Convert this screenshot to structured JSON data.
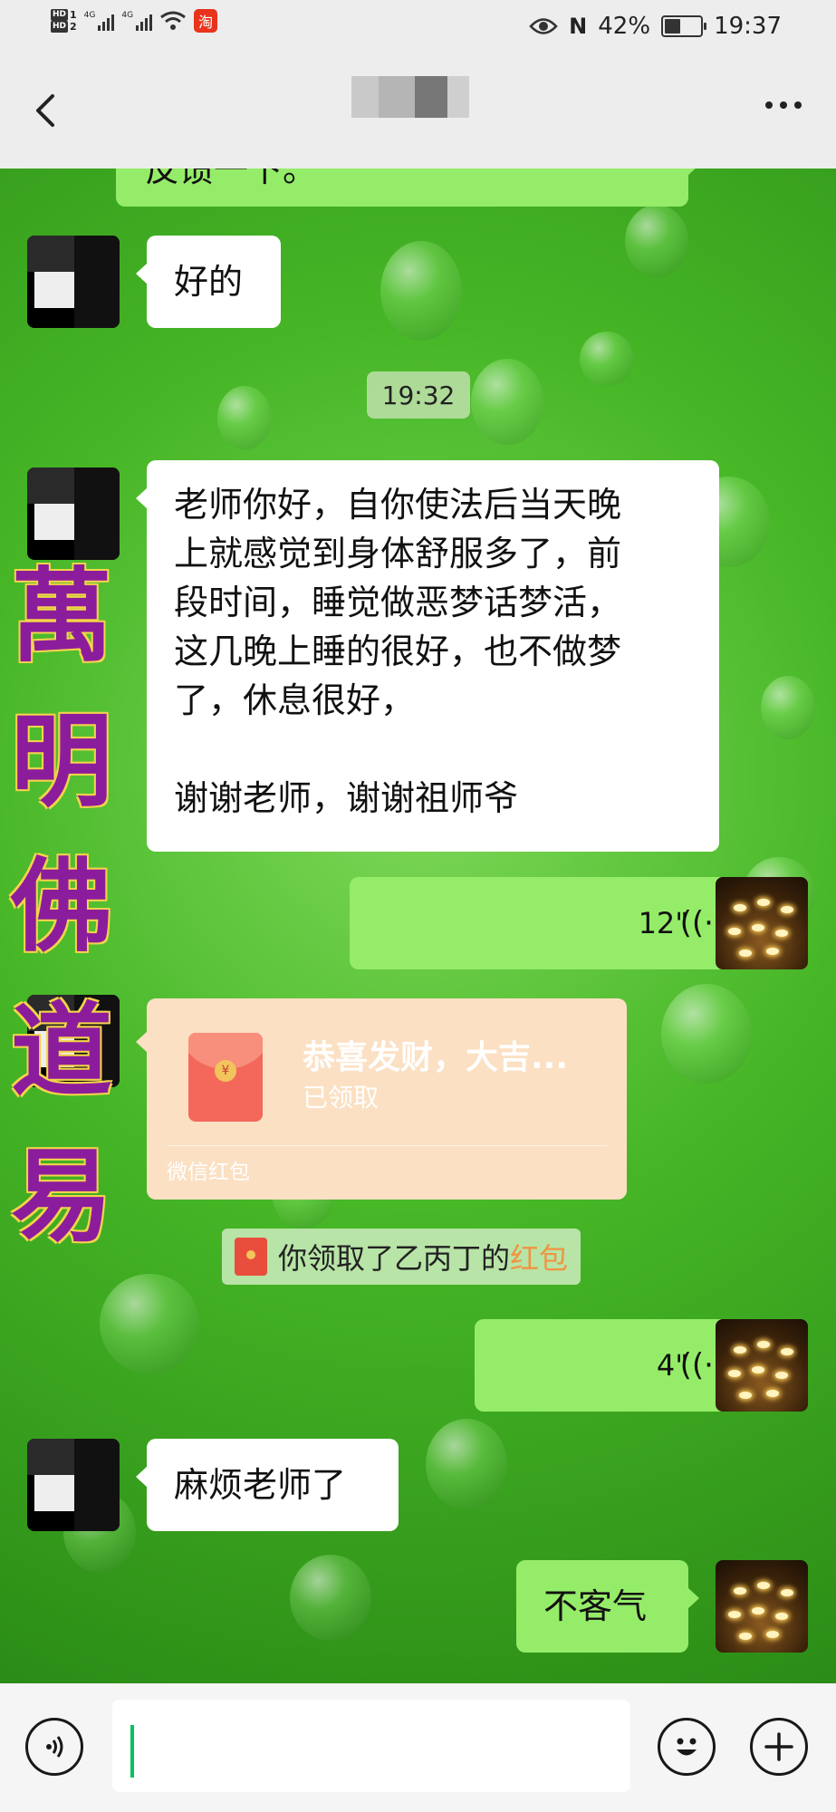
{
  "status_bar": {
    "hd1": "HD",
    "hd1_num": "1",
    "hd2": "HD",
    "hd2_num": "2",
    "net1": "4G",
    "net2": "4G",
    "taobao_glyph": "淘",
    "battery": "42%",
    "time": "19:37"
  },
  "header": {
    "title_blurred": true
  },
  "messages": {
    "m0_partial": "反馈一下。",
    "m1": "好的",
    "timestamp": "19:32",
    "m2_l1": "老师你好，自你使法后当天晚",
    "m2_l2": "上就感觉到身体舒服多了，前",
    "m2_l3": "段时间，睡觉做恶梦话梦活，",
    "m2_l4": "这几晚上睡的很好，也不做梦",
    "m2_l5": "了，休息很好，",
    "m2_l6": "谢谢老师，谢谢祖师爷",
    "voice1": "12\"",
    "voice2": "4\"",
    "m3": "麻烦老师了",
    "m4": "不客气"
  },
  "red_packet": {
    "title": "恭喜发财，大吉...",
    "status": "已领取",
    "footer": "微信红包",
    "coin_glyph": "¥"
  },
  "system_message": {
    "text": "你领取了乙丙丁的",
    "link": "红包"
  },
  "watermark": [
    "萬",
    "明",
    "佛",
    "道",
    "易"
  ],
  "colors": {
    "received_bubble": "#ffffff",
    "sent_bubble": "#95ec69",
    "red_packet_bg": "#fbe0c3",
    "watermark": "#8b1d9c",
    "caret": "#07c160"
  },
  "icons": [
    "back-arrow-icon",
    "more-icon",
    "voice-wave-icon",
    "voice-input-icon",
    "emoji-icon",
    "plus-icon",
    "red-packet-icon"
  ]
}
